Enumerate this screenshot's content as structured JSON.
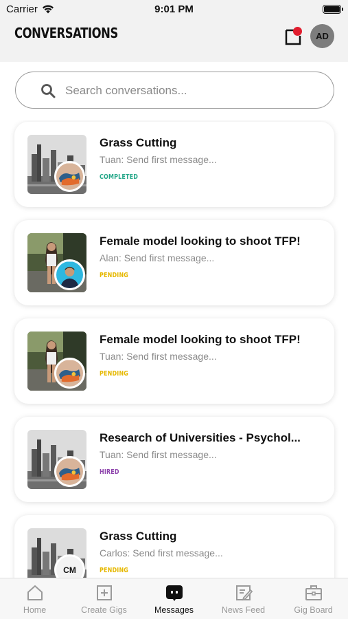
{
  "status_bar": {
    "carrier": "Carrier",
    "time": "9:01 PM"
  },
  "header": {
    "title": "CONVERSATIONS",
    "avatar_initials": "AD"
  },
  "search": {
    "placeholder": "Search conversations..."
  },
  "colors": {
    "completed": "#27a88a",
    "pending": "#e6b800",
    "hired": "#8e44ad",
    "notification": "#e11d2e"
  },
  "conversations": [
    {
      "title": "Grass Cutting",
      "message": "Tuan: Send first message...",
      "status": "COMPLETED",
      "thumb": "city",
      "avatar": "shoes"
    },
    {
      "title": "Female model looking to shoot TFP!",
      "message": "Alan: Send first message...",
      "status": "PENDING",
      "thumb": "model",
      "avatar": "person"
    },
    {
      "title": "Female model looking to shoot TFP!",
      "message": "Tuan: Send first message...",
      "status": "PENDING",
      "thumb": "model",
      "avatar": "shoes"
    },
    {
      "title": "Research of Universities - Psychol...",
      "message": "Tuan: Send first message...",
      "status": "HIRED",
      "thumb": "city",
      "avatar": "shoes"
    },
    {
      "title": "Grass Cutting",
      "message": "Carlos: Send first message...",
      "status": "PENDING",
      "thumb": "city",
      "avatar": "initials",
      "avatar_initials": "CM"
    }
  ],
  "tabs": [
    {
      "label": "Home",
      "icon": "home-icon"
    },
    {
      "label": "Create Gigs",
      "icon": "plus-square-icon"
    },
    {
      "label": "Messages",
      "icon": "chat-icon",
      "active": true
    },
    {
      "label": "News Feed",
      "icon": "edit-icon"
    },
    {
      "label": "Gig Board",
      "icon": "briefcase-icon"
    }
  ]
}
